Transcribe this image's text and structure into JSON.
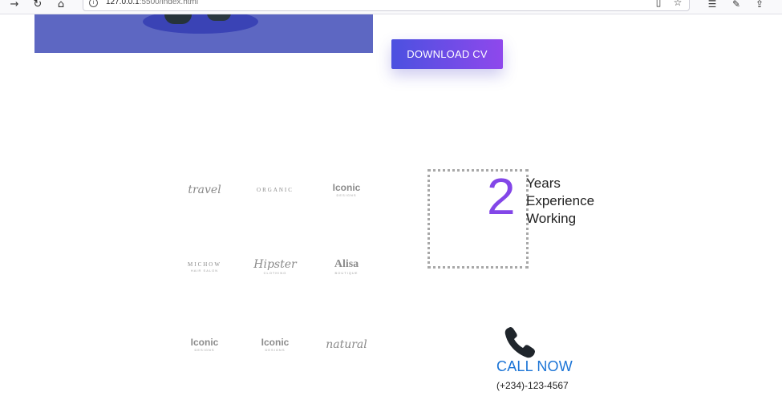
{
  "browser": {
    "url_host": "127.0.0.1",
    "url_rest": ":5500/index.html",
    "icons": [
      "forward-arrow-icon",
      "reload-icon",
      "home-icon",
      "site-info-icon",
      "reader-view-icon",
      "bookmark-star-icon",
      "favorites-icon",
      "collections-icon",
      "share-icon"
    ]
  },
  "hero": {
    "download_label": "DOWNLOAD CV"
  },
  "logos": [
    {
      "main": "travel",
      "sub": ""
    },
    {
      "main": "ORGANIC",
      "sub": ""
    },
    {
      "main": "Iconic",
      "sub": "DESIGNS"
    },
    {
      "main": "MICHOW",
      "sub": "HAIR SALON"
    },
    {
      "main": "Hipster",
      "sub": "CLOTHING"
    },
    {
      "main": "Alisa",
      "sub": "BOUTIQUE"
    },
    {
      "main": "Iconic",
      "sub": "DESIGNS"
    },
    {
      "main": "Iconic",
      "sub": "DESIGNS"
    },
    {
      "main": "natural",
      "sub": ""
    }
  ],
  "experience": {
    "number": "2",
    "line1": "Years",
    "line2": "Experience",
    "line3": "Working"
  },
  "contact": {
    "icon": "phone-icon",
    "call_label": "CALL NOW",
    "phone": "(+234)-123-4567"
  },
  "colors": {
    "accent_purple": "#8346e8",
    "button_gradient_start": "#4b51e0",
    "button_gradient_end": "#8f48ec",
    "link_blue": "#1b74d6",
    "hero_bg": "#5d67c2"
  }
}
